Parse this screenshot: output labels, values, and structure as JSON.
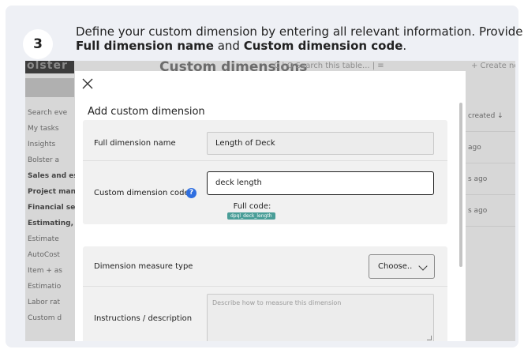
{
  "step": {
    "number": "3",
    "line1": "Define your custom dimension by entering all relevant information. Provide the",
    "line2_bold1": "Full dimension name",
    "line2_mid": " and ",
    "line2_bold2": "Custom dimension code",
    "line2_end": "."
  },
  "background_app": {
    "logo": "olster",
    "page_title": "Custom dimensions",
    "toolbar_text": "C  |  Q  Search this table...   |  ≡",
    "create_button": "+ Create new",
    "sidebar": [
      {
        "label": "Search eve",
        "bold": false
      },
      {
        "label": "My tasks",
        "bold": false
      },
      {
        "label": "Insights",
        "bold": false
      },
      {
        "label": "Bolster a",
        "bold": false
      },
      {
        "label": "Sales and esti",
        "bold": true
      },
      {
        "label": "Project manag",
        "bold": true
      },
      {
        "label": "Financial servi",
        "bold": true
      },
      {
        "label": "Estimating, ite",
        "bold": true
      },
      {
        "label": "Estimate",
        "bold": false
      },
      {
        "label": "AutoCost",
        "bold": false
      },
      {
        "label": "Item + as",
        "bold": false
      },
      {
        "label": "Estimatio",
        "bold": false
      },
      {
        "label": "Labor rat",
        "bold": false
      },
      {
        "label": "Custom d",
        "bold": false
      }
    ],
    "right_column": {
      "header": "created ↓",
      "cells": [
        "ago",
        "s ago",
        "s ago"
      ]
    }
  },
  "modal": {
    "close_label": "✕",
    "title": "Add custom dimension",
    "full_name_label": "Full dimension name",
    "full_name_value": "Length of Deck",
    "code_label": "Custom dimension code",
    "help_icon": "?",
    "code_value": "deck length",
    "full_code_label": "Full code:",
    "full_code_value": "dpql_deck_length",
    "measure_type_label": "Dimension measure type",
    "measure_type_value": "Choose..",
    "instructions_label": "Instructions / description",
    "instructions_placeholder": "Describe how to measure this dimension"
  }
}
